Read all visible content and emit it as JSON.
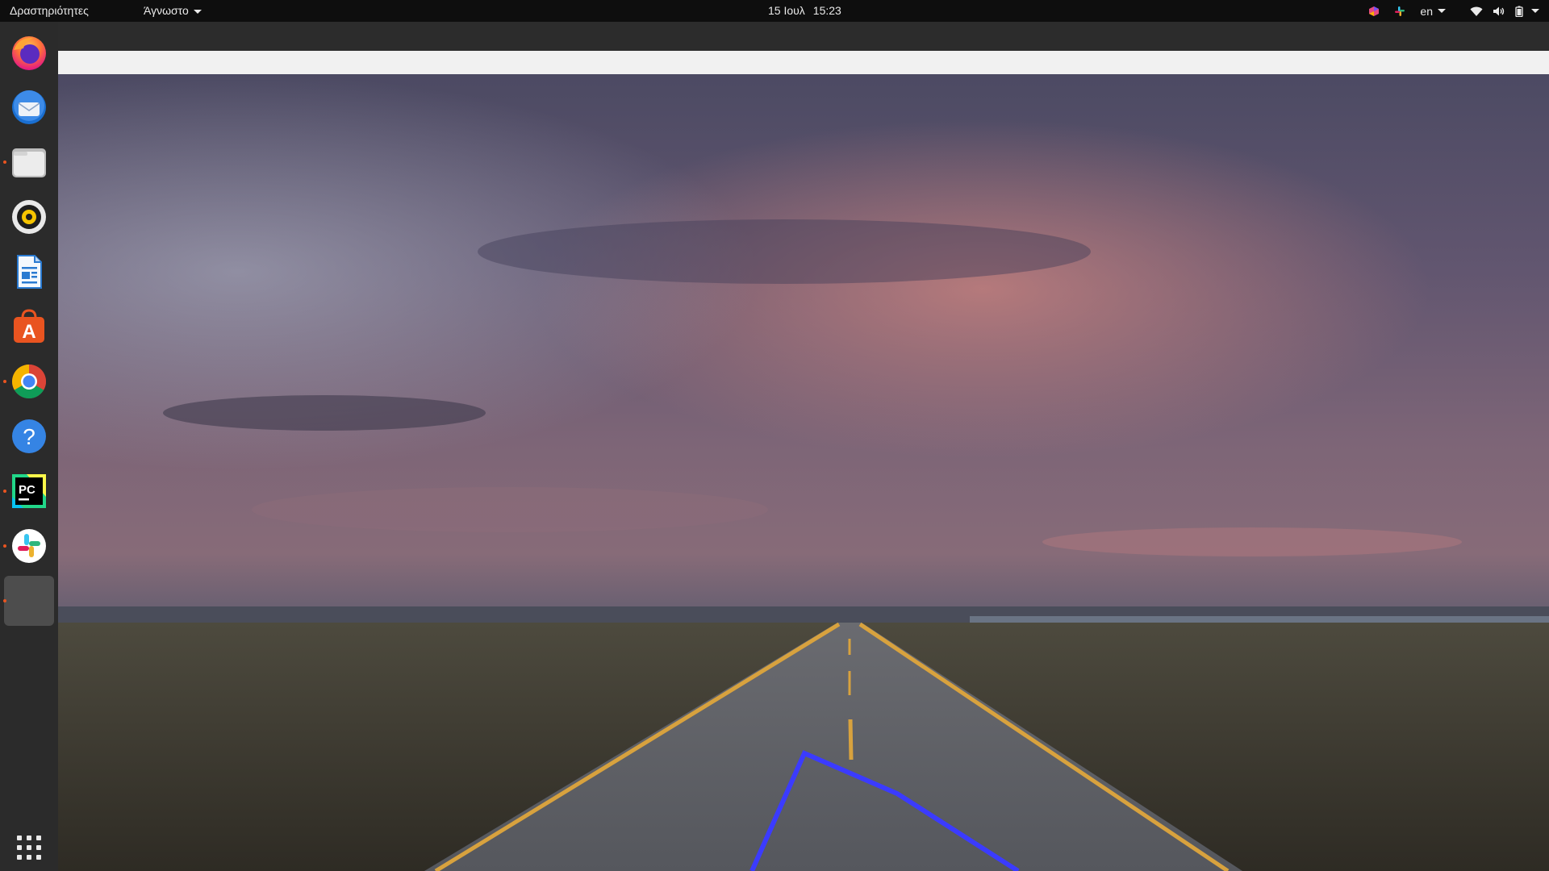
{
  "topbar": {
    "activities_label": "Δραστηριότητες",
    "app_menu_label": "Άγνωστο",
    "clock_date": "15 Ιουλ",
    "clock_time": "15:23",
    "language": "en"
  },
  "dock": {
    "items": [
      {
        "name": "firefox",
        "running": false
      },
      {
        "name": "thunderbird",
        "running": false
      },
      {
        "name": "files",
        "running": true
      },
      {
        "name": "rhythmbox",
        "running": false
      },
      {
        "name": "libreoffice-writer",
        "running": false
      },
      {
        "name": "ubuntu-software",
        "running": false
      },
      {
        "name": "google-chrome",
        "running": true
      },
      {
        "name": "help",
        "running": false
      },
      {
        "name": "pycharm",
        "running": true,
        "label": "PC"
      },
      {
        "name": "slack",
        "running": true
      },
      {
        "name": "unknown-app",
        "running": true
      }
    ],
    "help_glyph": "?",
    "software_glyph": "A"
  },
  "colors": {
    "topbar_bg": "#0e0e0e",
    "dock_bg": "#2b2b2b",
    "running_indicator": "#e95420",
    "window_header": "#2c2c2c",
    "window_strip": "#f1f1f1",
    "annotation_line": "#3b3bff"
  }
}
